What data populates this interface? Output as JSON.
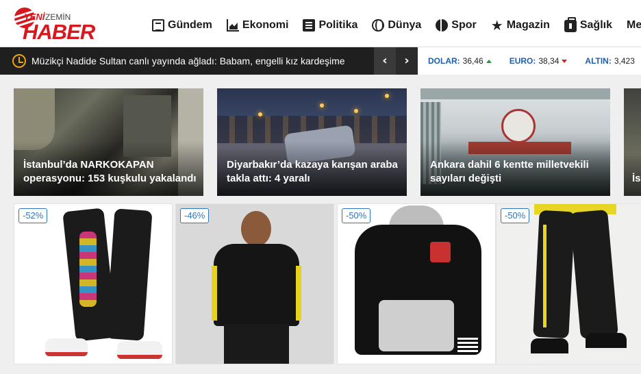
{
  "header": {
    "logo": {
      "yeni": "YENİ",
      "zemin": "ZEMİN",
      "haber": "HABER"
    },
    "nav": [
      {
        "label": "Gündem",
        "icon": "newspaper-icon"
      },
      {
        "label": "Ekonomi",
        "icon": "chart-area-icon"
      },
      {
        "label": "Politika",
        "icon": "list-icon"
      },
      {
        "label": "Dünya",
        "icon": "globe-icon"
      },
      {
        "label": "Spor",
        "icon": "basketball-icon"
      },
      {
        "label": "Magazin",
        "icon": "star-icon"
      },
      {
        "label": "Sağlık",
        "icon": "medkit-icon"
      },
      {
        "label": "Me",
        "icon": ""
      }
    ]
  },
  "ticker": {
    "headline": "Müzikçi Nadide Sultan canlı yayında ağladı: Babam, engelli kız kardeşime",
    "prev": "‹",
    "next": "›",
    "rates": [
      {
        "label": "DOLAR:",
        "value": "36,46",
        "trend": "up",
        "color": "#1a9e3c"
      },
      {
        "label": "EURO:",
        "value": "38,34",
        "trend": "down",
        "color": "#d62020"
      },
      {
        "label": "ALTIN:",
        "value": "3,423",
        "trend": "",
        "color": ""
      }
    ]
  },
  "news": [
    {
      "title": "İstanbul’da NARKOKAPAN operasyonu: 153 kuşkulu yakalandı"
    },
    {
      "title": "Diyarbakır’da kazaya karışan araba takla attı: 4 yaralı"
    },
    {
      "title": "Ankara dahil 6 kentte milletvekili sayıları değişti"
    },
    {
      "title": "İs ça..."
    }
  ],
  "products": [
    {
      "discount": "-52%"
    },
    {
      "discount": "-46%"
    },
    {
      "discount": "-50%"
    },
    {
      "discount": "-50%"
    }
  ],
  "colors": {
    "brand": "#d6191f",
    "ticker_bg": "#1f1f1f",
    "clock": "#f0a500",
    "rate_label": "#1b5fb0",
    "badge": "#2f74c0"
  }
}
